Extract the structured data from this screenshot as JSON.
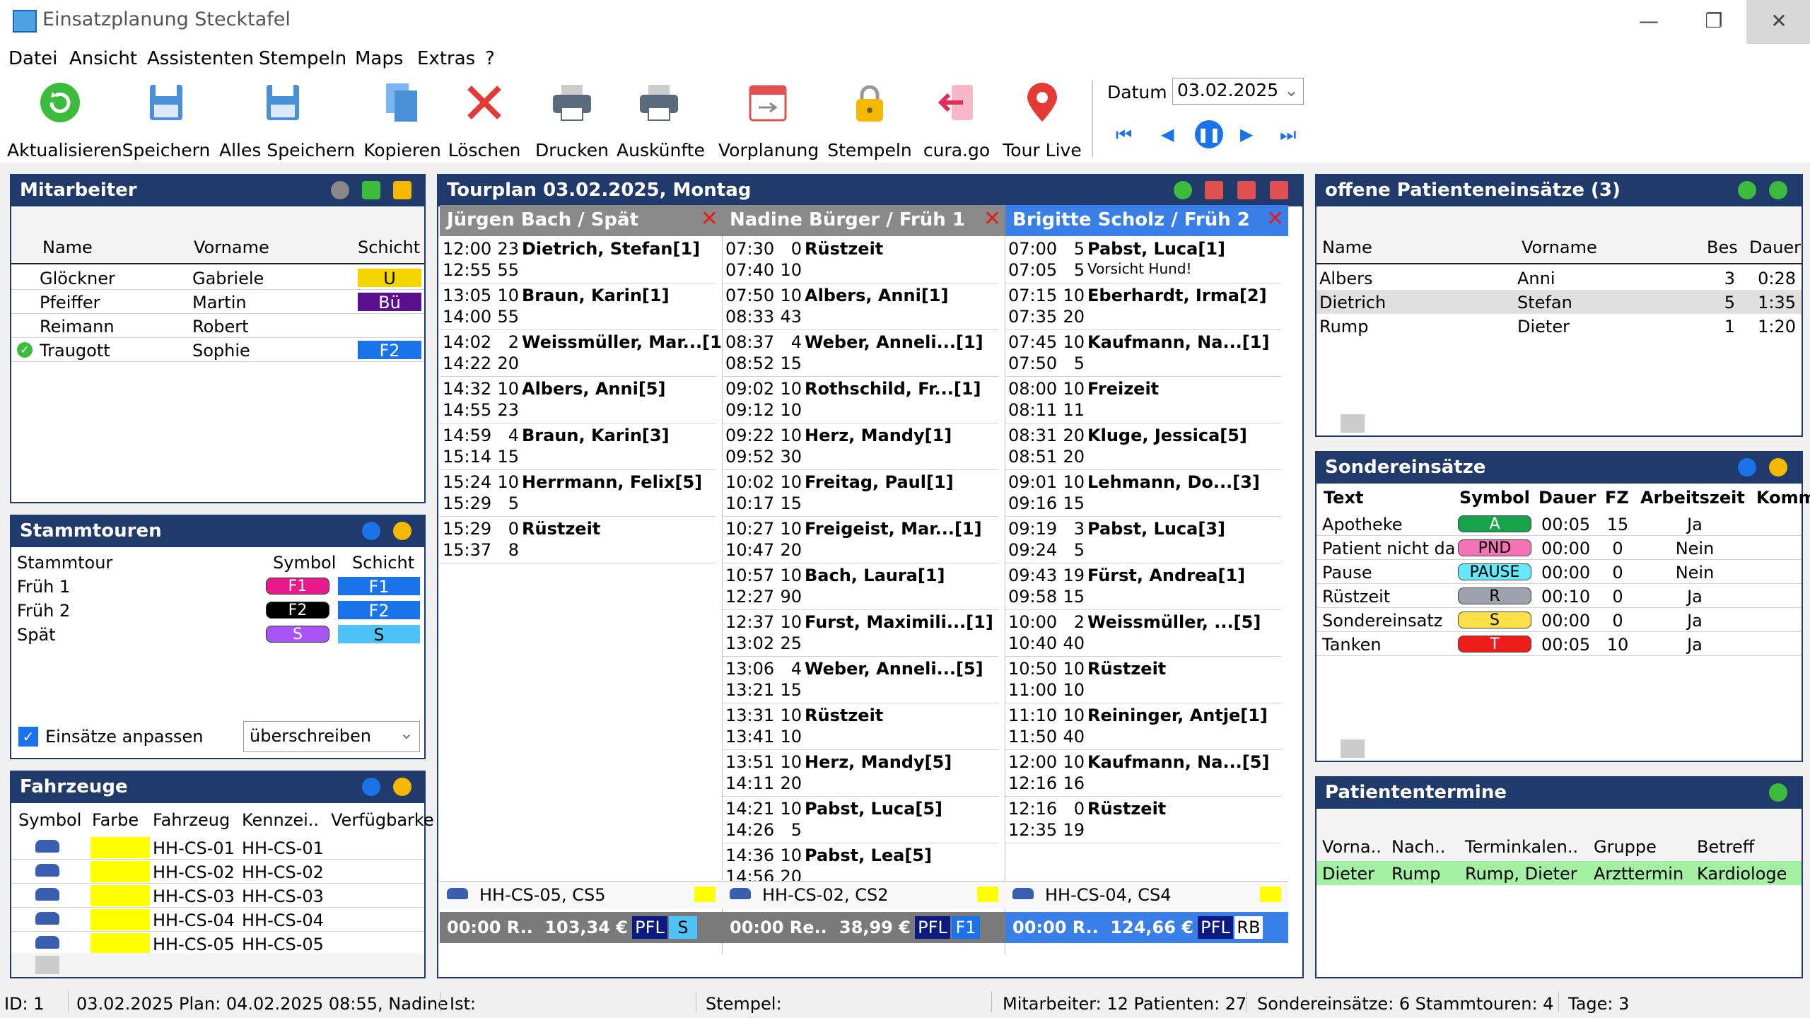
{
  "window": {
    "title": "Einsatzplanung Stecktafel",
    "min": "—",
    "max": "❐",
    "close": "✕"
  },
  "menu": [
    "Datei",
    "Ansicht",
    "Assistenten",
    "Stempeln",
    "Maps",
    "Extras",
    "?"
  ],
  "toolbar": {
    "items": [
      "Aktualisieren",
      "Speichern",
      "Alles Speichern",
      "Kopieren",
      "Löschen",
      "Drucken",
      "Auskünfte",
      "Vorplanung",
      "Stempeln",
      "cura.go",
      "Tour Live"
    ],
    "date_label": "Datum",
    "date_value": "03.02.2025"
  },
  "mitarbeiter": {
    "title": "Mitarbeiter",
    "cols": [
      "Name",
      "Vorname",
      "Schicht"
    ],
    "rows": [
      {
        "name": "Glöckner",
        "vorname": "Gabriele",
        "schicht": "U",
        "color": "#f5d400",
        "tc": "#000"
      },
      {
        "name": "Pfeiffer",
        "vorname": "Martin",
        "schicht": "Bü",
        "color": "#5a0f8f",
        "tc": "#fff"
      },
      {
        "name": "Reimann",
        "vorname": "Robert",
        "schicht": "",
        "color": "",
        "tc": "#000"
      },
      {
        "name": "Traugott",
        "vorname": "Sophie",
        "schicht": "F2",
        "color": "#1a73e8",
        "tc": "#fff"
      }
    ]
  },
  "stammtouren": {
    "title": "Stammtouren",
    "cols": [
      "Stammtour",
      "Symbol",
      "Schicht"
    ],
    "rows": [
      {
        "name": "Früh 1",
        "symbol": "F1",
        "sc": "#e8198b",
        "stc": "#fff",
        "schicht": "F1",
        "hc": "#1a73e8",
        "htc": "#fff"
      },
      {
        "name": "Früh 2",
        "symbol": "F2",
        "sc": "#000",
        "stc": "#fff",
        "schicht": "F2",
        "hc": "#1a73e8",
        "htc": "#fff"
      },
      {
        "name": "Spät",
        "symbol": "S",
        "sc": "#a855f7",
        "stc": "#fff",
        "schicht": "S",
        "hc": "#4fc3f7",
        "htc": "#000"
      }
    ],
    "checkbox_label": "Einsätze anpassen",
    "select_value": "überschreiben"
  },
  "fahrzeuge": {
    "title": "Fahrzeuge",
    "cols": [
      "Symbol",
      "Farbe",
      "Fahrzeug",
      "Kennzei..",
      "Verfügbarke"
    ],
    "rows": [
      {
        "fz": "HH-CS-01",
        "kz": "HH-CS-01"
      },
      {
        "fz": "HH-CS-02",
        "kz": "HH-CS-02"
      },
      {
        "fz": "HH-CS-03",
        "kz": "HH-CS-03"
      },
      {
        "fz": "HH-CS-04",
        "kz": "HH-CS-04"
      },
      {
        "fz": "HH-CS-05",
        "kz": "HH-CS-05"
      }
    ]
  },
  "tourplan": {
    "title": "Tourplan 03.02.2025, Montag",
    "tours": [
      {
        "header": "Jürgen Bach / Spät",
        "hbg": "#8a8a8a",
        "lines": [
          [
            "12:00",
            "23",
            "Dietrich, Stefan[1]"
          ],
          [
            "12:55",
            "55",
            ""
          ],
          [
            "13:05",
            "10",
            "Braun, Karin[1]"
          ],
          [
            "14:00",
            "55",
            ""
          ],
          [
            "14:02",
            "2",
            "Weissmüller, Mar...[1]"
          ],
          [
            "14:22",
            "20",
            ""
          ],
          [
            "14:32",
            "10",
            "Albers, Anni[5]"
          ],
          [
            "14:55",
            "23",
            ""
          ],
          [
            "14:59",
            "4",
            "Braun, Karin[3]"
          ],
          [
            "15:14",
            "15",
            ""
          ],
          [
            "15:24",
            "10",
            "Herrmann, Felix[5]"
          ],
          [
            "15:29",
            "5",
            ""
          ],
          [
            "15:29",
            "0",
            "Rüstzeit"
          ],
          [
            "15:37",
            "8",
            ""
          ]
        ],
        "vehicle": "HH-CS-05, CS5",
        "sum": "00:00 R..",
        "amount": "103,34 €",
        "pfl": "PFL",
        "tag": "S",
        "tagc": "#4fc3f7"
      },
      {
        "header": "Nadine Bürger / Früh 1",
        "hbg": "#8a8a8a",
        "lines": [
          [
            "07:30",
            "0",
            "Rüstzeit"
          ],
          [
            "07:40",
            "10",
            ""
          ],
          [
            "07:50",
            "10",
            "Albers, Anni[1]"
          ],
          [
            "08:33",
            "43",
            ""
          ],
          [
            "08:37",
            "4",
            "Weber, Anneli...[1]"
          ],
          [
            "08:52",
            "15",
            ""
          ],
          [
            "09:02",
            "10",
            "Rothschild, Fr...[1]"
          ],
          [
            "09:12",
            "10",
            ""
          ],
          [
            "09:22",
            "10",
            "Herz, Mandy[1]"
          ],
          [
            "09:52",
            "30",
            ""
          ],
          [
            "10:02",
            "10",
            "Freitag, Paul[1]"
          ],
          [
            "10:17",
            "15",
            ""
          ],
          [
            "10:27",
            "10",
            "Freigeist, Mar...[1]"
          ],
          [
            "10:47",
            "20",
            ""
          ],
          [
            "10:57",
            "10",
            "Bach, Laura[1]"
          ],
          [
            "12:27",
            "90",
            ""
          ],
          [
            "12:37",
            "10",
            "Furst, Maximili...[1]"
          ],
          [
            "13:02",
            "25",
            ""
          ],
          [
            "13:06",
            "4",
            "Weber, Anneli...[5]"
          ],
          [
            "13:21",
            "15",
            ""
          ],
          [
            "13:31",
            "10",
            "Rüstzeit"
          ],
          [
            "13:41",
            "10",
            ""
          ],
          [
            "13:51",
            "10",
            "Herz, Mandy[5]"
          ],
          [
            "14:11",
            "20",
            ""
          ],
          [
            "14:21",
            "10",
            "Pabst, Luca[5]"
          ],
          [
            "14:26",
            "5",
            ""
          ],
          [
            "14:36",
            "10",
            "Pabst, Lea[5]"
          ],
          [
            "14:56",
            "20",
            ""
          ]
        ],
        "vehicle": "HH-CS-02, CS2",
        "sum": "00:00 Re..",
        "amount": "38,99 €",
        "pfl": "PFL",
        "tag": "F1",
        "tagc": "#1a73e8"
      },
      {
        "header": "Brigitte Scholz / Früh 2",
        "hbg": "#3a7ee8",
        "lines": [
          [
            "07:00",
            "5",
            "Pabst, Luca[1]"
          ],
          [
            "07:05",
            "5",
            "Vorsicht Hund!"
          ],
          [
            "07:15",
            "10",
            "Eberhardt, Irma[2]"
          ],
          [
            "07:35",
            "20",
            ""
          ],
          [
            "07:45",
            "10",
            "Kaufmann, Na...[1]"
          ],
          [
            "07:50",
            "5",
            ""
          ],
          [
            "08:00",
            "10",
            "Freizeit"
          ],
          [
            "08:11",
            "11",
            ""
          ],
          [
            "08:31",
            "20",
            "Kluge, Jessica[5]"
          ],
          [
            "08:51",
            "20",
            ""
          ],
          [
            "09:01",
            "10",
            "Lehmann, Do...[3]"
          ],
          [
            "09:16",
            "15",
            ""
          ],
          [
            "09:19",
            "3",
            "Pabst, Luca[3]"
          ],
          [
            "09:24",
            "5",
            ""
          ],
          [
            "09:43",
            "19",
            "Fürst, Andrea[1]"
          ],
          [
            "09:58",
            "15",
            ""
          ],
          [
            "10:00",
            "2",
            "Weissmüller, ...[5]"
          ],
          [
            "10:40",
            "40",
            ""
          ],
          [
            "10:50",
            "10",
            "Rüstzeit"
          ],
          [
            "11:00",
            "10",
            ""
          ],
          [
            "11:10",
            "10",
            "Reininger, Antje[1]"
          ],
          [
            "11:50",
            "40",
            ""
          ],
          [
            "12:00",
            "10",
            "Kaufmann, Na...[5]"
          ],
          [
            "12:16",
            "16",
            ""
          ],
          [
            "12:16",
            "0",
            "Rüstzeit"
          ],
          [
            "12:35",
            "19",
            ""
          ]
        ],
        "vehicle": "HH-CS-04, CS4",
        "sum": "00:00 R..",
        "amount": "124,66 €",
        "pfl": "PFL",
        "tag": "RB",
        "tagc": "#ffffff"
      }
    ]
  },
  "offene": {
    "title": "offene Patienteneinsätze (3)",
    "cols": [
      "Name",
      "Vorname",
      "Bes",
      "Dauer"
    ],
    "rows": [
      [
        "Albers",
        "Anni",
        "3",
        "0:28"
      ],
      [
        "Dietrich",
        "Stefan",
        "5",
        "1:35"
      ],
      [
        "Rump",
        "Dieter",
        "1",
        "1:20"
      ]
    ]
  },
  "sonder": {
    "title": "Sondereinsätze",
    "cols": [
      "Text",
      "Symbol",
      "Dauer",
      "FZ",
      "Arbeitszeit",
      "Komm"
    ],
    "rows": [
      {
        "text": "Apotheke",
        "sym": "A",
        "c": "#17a34a",
        "tc": "#fff",
        "dauer": "00:05",
        "fz": "15",
        "az": "Ja"
      },
      {
        "text": "Patient nicht da",
        "sym": "PND",
        "c": "#f472b6",
        "tc": "#000",
        "dauer": "00:00",
        "fz": "0",
        "az": "Nein"
      },
      {
        "text": "Pause",
        "sym": "PAUSE",
        "c": "#67e8f9",
        "tc": "#000",
        "dauer": "00:00",
        "fz": "0",
        "az": "Nein"
      },
      {
        "text": "Rüstzeit",
        "sym": "R",
        "c": "#9ca3af",
        "tc": "#000",
        "dauer": "00:10",
        "fz": "0",
        "az": "Ja"
      },
      {
        "text": "Sondereinsatz",
        "sym": "S",
        "c": "#fde047",
        "tc": "#000",
        "dauer": "00:00",
        "fz": "0",
        "az": "Ja"
      },
      {
        "text": "Tanken",
        "sym": "T",
        "c": "#ef1c1c",
        "tc": "#fff",
        "dauer": "00:05",
        "fz": "10",
        "az": "Ja"
      }
    ]
  },
  "termine": {
    "title": "Patiententermine",
    "cols": [
      "Vorna..",
      "Nach..",
      "Terminkalen..",
      "Gruppe",
      "Betreff"
    ],
    "row": [
      "Dieter",
      "Rump",
      "Rump, Dieter",
      "Arzttermin",
      "Kardiologe"
    ]
  },
  "status": [
    "ID: 1",
    "03.02.2025 Plan: 04.02.2025 08:55, Nadine",
    "Ist:",
    "Stempel:",
    "Mitarbeiter: 12 Patienten: 27",
    "Sondereinsätze: 6 Stammtouren: 4",
    "Tage: 3"
  ]
}
